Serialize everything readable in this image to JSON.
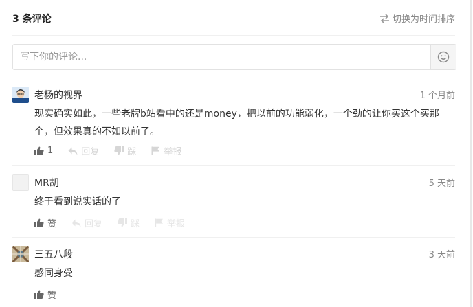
{
  "header": {
    "count_label": "3 条评论",
    "sort_label": "切换为时间排序"
  },
  "input": {
    "placeholder": "写下你的评论..."
  },
  "comments": [
    {
      "user": "老杨的视界",
      "time": "1 个月前",
      "content": "现实确实如此，一些老牌b站看中的还是money，把以前的功能弱化，一个劲的让你买这个买那个，但效果真的不如以前了。",
      "like_label": "1",
      "reply_label": "回复",
      "dislike_label": "踩",
      "report_label": "举报"
    },
    {
      "user": "MR胡",
      "time": "5 天前",
      "content": "终于看到说实话的了",
      "like_label": "赞",
      "reply_label": "回复",
      "dislike_label": "踩",
      "report_label": "举报"
    },
    {
      "user": "三五八段",
      "time": "3 天前",
      "content": "感同身受",
      "like_label": "赞"
    }
  ],
  "colors": {
    "text": "#333333",
    "muted": "#888888",
    "faint": "#d6d6d6",
    "divider": "#f0f0f0"
  }
}
